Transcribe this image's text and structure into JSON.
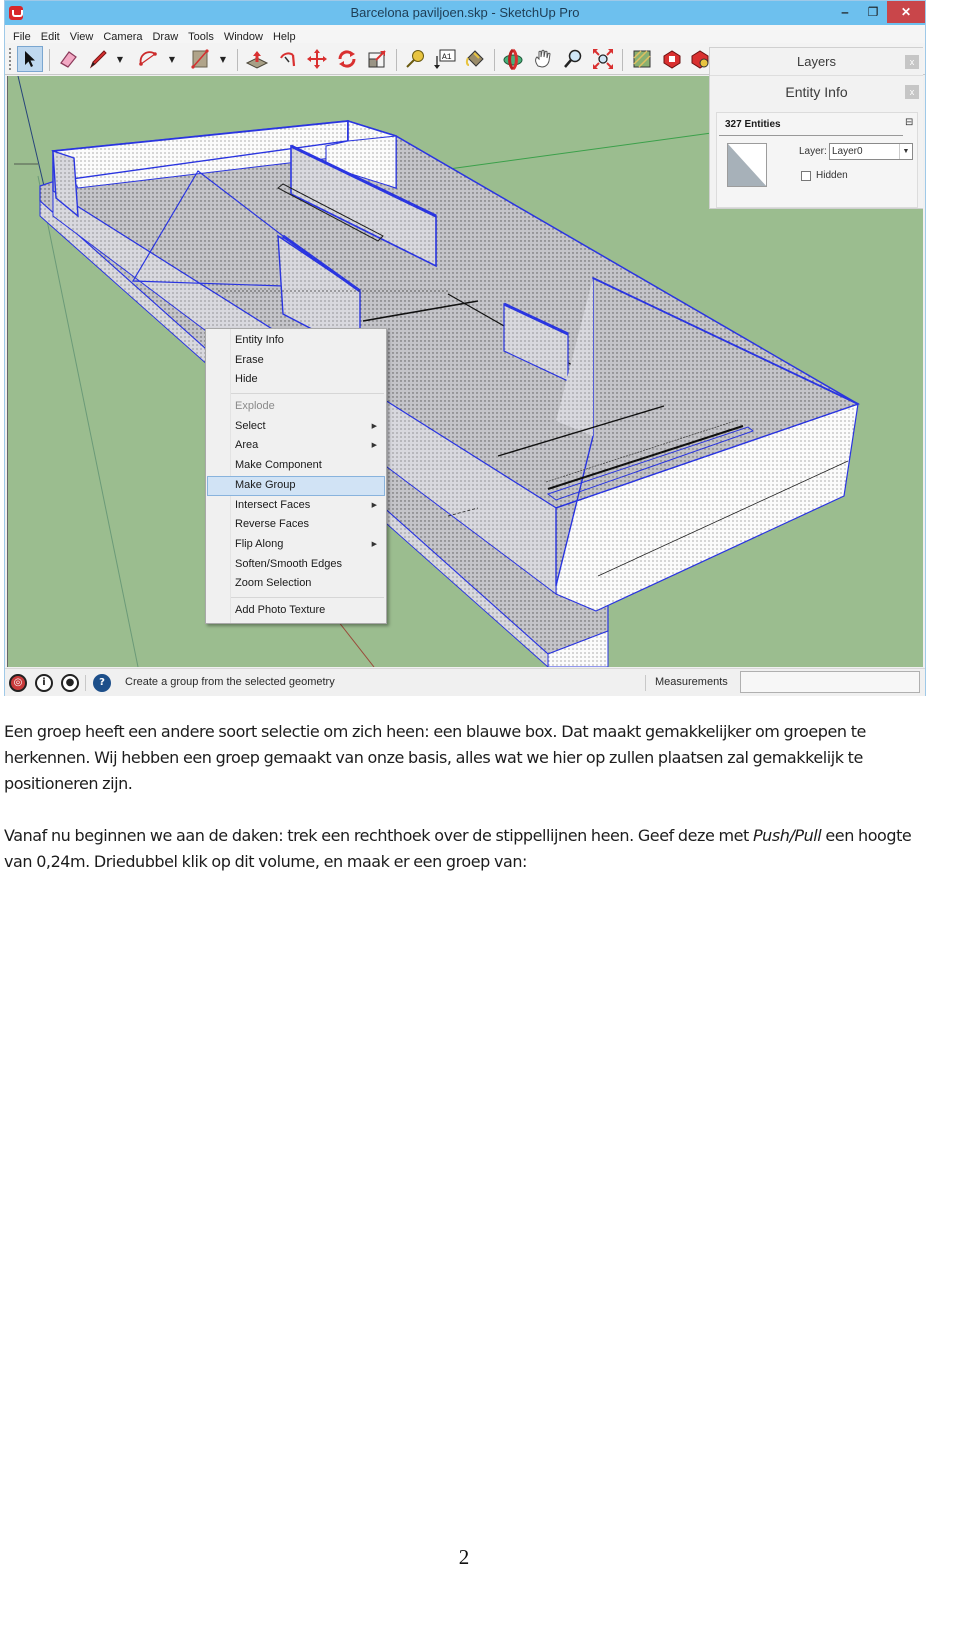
{
  "window": {
    "title": "Barcelona paviljoen.skp - SketchUp Pro",
    "controls": {
      "minimize": "‒",
      "maximize": "❐",
      "close": "✕"
    }
  },
  "menubar": [
    "File",
    "Edit",
    "View",
    "Camera",
    "Draw",
    "Tools",
    "Window",
    "Help"
  ],
  "toolbar": {
    "tools": [
      {
        "name": "select-tool",
        "glyph": "➤",
        "active": true
      },
      {
        "name": "eraser-tool",
        "glyph": "◆"
      },
      {
        "name": "pencil-line-tool",
        "glyph": "✎"
      },
      {
        "name": "arc-tool",
        "glyph": "◠"
      },
      {
        "name": "rectangle-tool",
        "glyph": "▧"
      },
      {
        "name": "push-pull-tool",
        "glyph": "⬆"
      },
      {
        "name": "follow-me-tool",
        "glyph": "↻"
      },
      {
        "name": "move-tool",
        "glyph": "✥"
      },
      {
        "name": "rotate-tool",
        "glyph": "⟳"
      },
      {
        "name": "scale-tool",
        "glyph": "⬚"
      },
      {
        "name": "tape-measure-tool",
        "glyph": "⌀"
      },
      {
        "name": "text-tool",
        "glyph": "A1"
      },
      {
        "name": "paint-bucket-tool",
        "glyph": "⛽"
      },
      {
        "name": "orbit-tool",
        "glyph": "◉"
      },
      {
        "name": "pan-tool",
        "glyph": "✋"
      },
      {
        "name": "zoom-tool",
        "glyph": "⌕"
      },
      {
        "name": "zoom-extents-tool",
        "glyph": "⤧"
      },
      {
        "name": "3d-warehouse-tool",
        "glyph": "▦"
      },
      {
        "name": "extension-warehouse-tool",
        "glyph": "◈"
      },
      {
        "name": "extension-manager-tool",
        "glyph": "◈"
      }
    ]
  },
  "context_menu": {
    "items": [
      {
        "label": "Entity Info"
      },
      {
        "label": "Erase"
      },
      {
        "label": "Hide"
      },
      {
        "separator": true
      },
      {
        "label": "Explode",
        "disabled": true
      },
      {
        "label": "Select",
        "submenu": true
      },
      {
        "label": "Area",
        "submenu": true
      },
      {
        "label": "Make Component"
      },
      {
        "label": "Make Group",
        "selected": true
      },
      {
        "label": "Intersect Faces",
        "submenu": true
      },
      {
        "label": "Reverse Faces"
      },
      {
        "label": "Flip Along",
        "submenu": true
      },
      {
        "label": "Soften/Smooth Edges"
      },
      {
        "label": "Zoom Selection"
      },
      {
        "separator": true
      },
      {
        "label": "Add Photo Texture"
      }
    ],
    "submenu_arrow": "▶"
  },
  "tray": {
    "layers_title": "Layers",
    "entity_info_title": "Entity Info",
    "close_glyph": "x",
    "entity_count": "327 Entities",
    "layer_label": "Layer:",
    "layer_value": "Layer0",
    "hidden_label": "Hidden",
    "hidden_checked": false,
    "pin_glyph": "⊟",
    "dropdown_glyph": "▼"
  },
  "statusbar": {
    "icons": [
      "geo-location-icon",
      "credits-icon",
      "user-account-icon",
      "help-icon"
    ],
    "help_glyph": "?",
    "info_glyph": "i",
    "user_glyph": "●",
    "geo_glyph": "◎",
    "message": "Create a group from the selected geometry",
    "measurements_label": "Measurements",
    "measurements_value": ""
  },
  "colors": {
    "titlebar": "#6dc0ee",
    "viewport_bg": "#9bbd8f",
    "selection_blue": "#2a35e0",
    "close_button": "#c9464a",
    "menu_highlight": "#d1e3f5"
  },
  "document": {
    "paragraph1": "Een groep heeft een andere soort selectie om zich heen: een blauwe box. Dat maakt gemakkelijker om groepen te herkennen. Wij hebben een groep gemaakt van onze basis, alles wat we hier op zullen plaatsen zal gemakkelijk te positioneren zijn.",
    "paragraph2_before": "Vanaf nu beginnen we aan de daken: trek een rechthoek over de stippellijnen heen. Geef deze met ",
    "paragraph2_emphasis": "Push/Pull",
    "paragraph2_after": " een hoogte van 0,24m. Driedubbel klik op dit volume, en maak er een groep van:",
    "page_number": "2"
  }
}
